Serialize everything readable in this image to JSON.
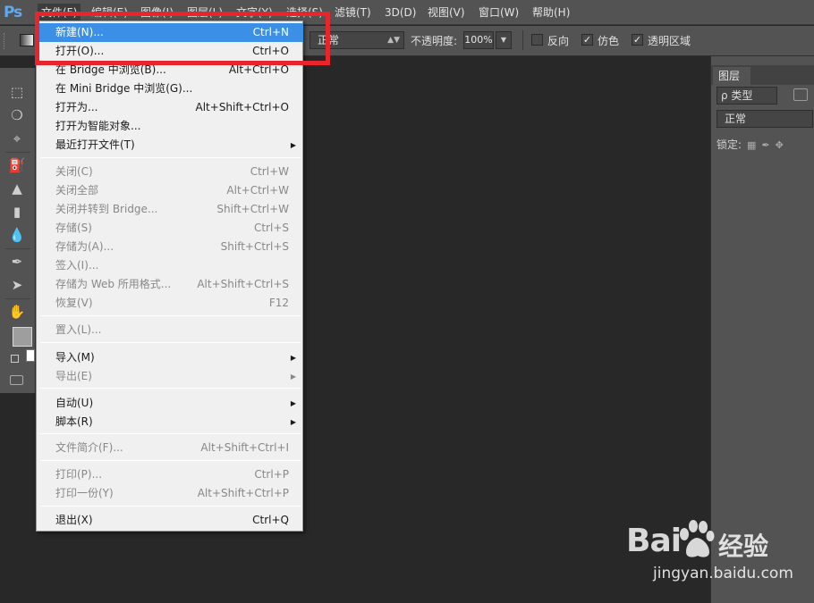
{
  "app": {
    "logo": "Ps"
  },
  "menubar": {
    "items": [
      "文件(F)",
      "编辑(E)",
      "图像(I)",
      "图层(L)",
      "文字(Y)",
      "选择(S)",
      "滤镜(T)",
      "3D(D)",
      "视图(V)",
      "窗口(W)",
      "帮助(H)"
    ]
  },
  "options": {
    "mode_value": "正常",
    "opacity_label": "不透明度:",
    "opacity_value": "100%",
    "reverse_label": "反向",
    "reverse_checked": false,
    "dither_label": "仿色",
    "dither_checked": true,
    "transparency_label": "透明区域",
    "transparency_checked": true
  },
  "file_menu": {
    "groups": [
      [
        {
          "label": "新建(N)...",
          "shortcut": "Ctrl+N",
          "enabled": true,
          "highlighted": true
        },
        {
          "label": "打开(O)...",
          "shortcut": "Ctrl+O",
          "enabled": true
        },
        {
          "label": "在 Bridge 中浏览(B)...",
          "shortcut": "Alt+Ctrl+O",
          "enabled": true
        },
        {
          "label": "在 Mini Bridge 中浏览(G)...",
          "shortcut": "",
          "enabled": true
        },
        {
          "label": "打开为...",
          "shortcut": "Alt+Shift+Ctrl+O",
          "enabled": true
        },
        {
          "label": "打开为智能对象...",
          "shortcut": "",
          "enabled": true
        },
        {
          "label": "最近打开文件(T)",
          "shortcut": "",
          "enabled": true,
          "submenu": true
        }
      ],
      [
        {
          "label": "关闭(C)",
          "shortcut": "Ctrl+W",
          "enabled": false
        },
        {
          "label": "关闭全部",
          "shortcut": "Alt+Ctrl+W",
          "enabled": false
        },
        {
          "label": "关闭并转到 Bridge...",
          "shortcut": "Shift+Ctrl+W",
          "enabled": false
        },
        {
          "label": "存储(S)",
          "shortcut": "Ctrl+S",
          "enabled": false
        },
        {
          "label": "存储为(A)...",
          "shortcut": "Shift+Ctrl+S",
          "enabled": false
        },
        {
          "label": "签入(I)...",
          "shortcut": "",
          "enabled": false
        },
        {
          "label": "存储为 Web 所用格式...",
          "shortcut": "Alt+Shift+Ctrl+S",
          "enabled": false
        },
        {
          "label": "恢复(V)",
          "shortcut": "F12",
          "enabled": false
        }
      ],
      [
        {
          "label": "置入(L)...",
          "shortcut": "",
          "enabled": false
        }
      ],
      [
        {
          "label": "导入(M)",
          "shortcut": "",
          "enabled": true,
          "submenu": true
        },
        {
          "label": "导出(E)",
          "shortcut": "",
          "enabled": false,
          "submenu": true
        }
      ],
      [
        {
          "label": "自动(U)",
          "shortcut": "",
          "enabled": true,
          "submenu": true
        },
        {
          "label": "脚本(R)",
          "shortcut": "",
          "enabled": true,
          "submenu": true
        }
      ],
      [
        {
          "label": "文件简介(F)...",
          "shortcut": "Alt+Shift+Ctrl+I",
          "enabled": false
        }
      ],
      [
        {
          "label": "打印(P)...",
          "shortcut": "Ctrl+P",
          "enabled": false
        },
        {
          "label": "打印一份(Y)",
          "shortcut": "Alt+Shift+Ctrl+P",
          "enabled": false
        }
      ],
      [
        {
          "label": "退出(X)",
          "shortcut": "Ctrl+Q",
          "enabled": true
        }
      ]
    ]
  },
  "layers_panel": {
    "tab_label": "图层",
    "kind_label": "ρ 类型",
    "blend_mode": "正常",
    "lock_label": "锁定:"
  },
  "watermark": {
    "logo_text": "Bai",
    "logo_suffix": "经验",
    "url": "jingyan.baidu.com"
  },
  "colors": {
    "highlight": "#3c8fe6",
    "annotation_box": "#e8242c",
    "foreground_swatch": "#9e9e9e",
    "background_swatch": "#ffffff"
  }
}
